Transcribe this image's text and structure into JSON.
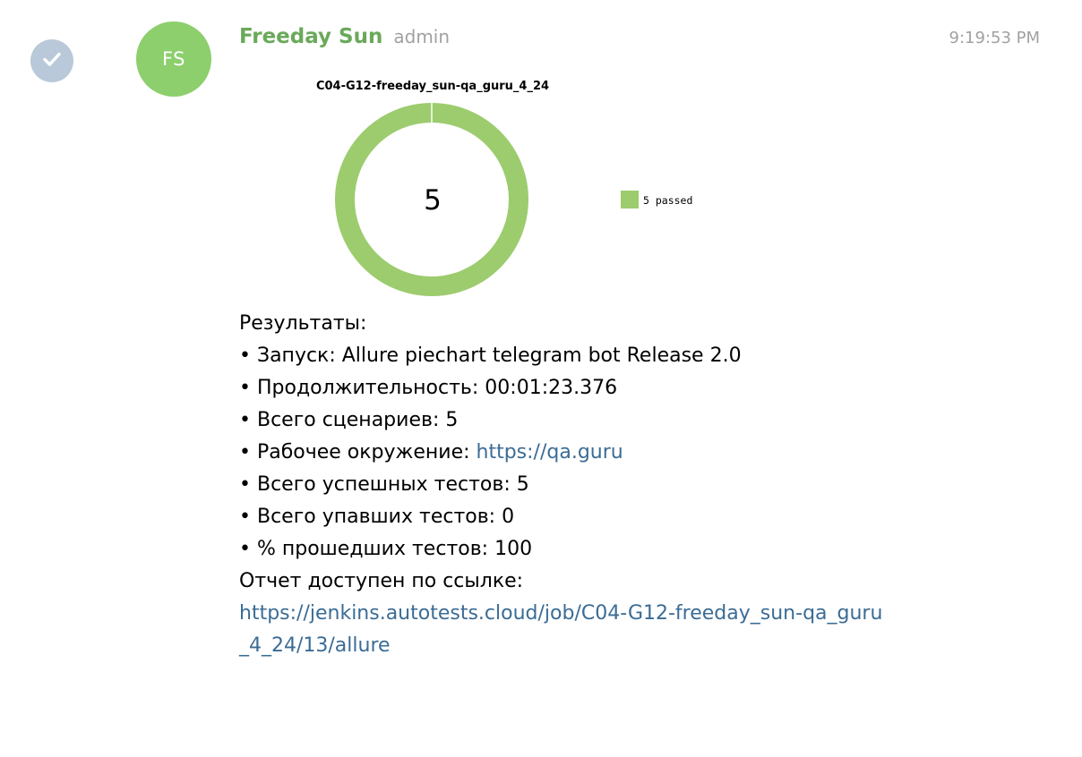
{
  "message": {
    "sender_initials": "FS",
    "sender_name": "Freeday Sun",
    "sender_role": "admin",
    "time": "9:19:53 PM",
    "results_heading": "Результаты:",
    "items": [
      {
        "label": "• Запуск: ",
        "value": "Allure piechart telegram bot Release 2.0"
      },
      {
        "label": "• Продолжительность: ",
        "value": "00:01:23.376"
      },
      {
        "label": "• Всего сценариев: ",
        "value": "5"
      },
      {
        "label": "• Рабочее окружение: ",
        "link": "https://qa.guru"
      },
      {
        "label": "• Всего успешных тестов: ",
        "value": "5"
      },
      {
        "label": "• Всего упавших тестов: ",
        "value": "0"
      },
      {
        "label": "• % прошедших тестов: ",
        "value": "100"
      }
    ],
    "report_label": "Отчет доступен по ссылке:",
    "report_link": "https://jenkins.autotests.cloud/job/C04-G12-freeday_sun-qa_guru_4_24/13/allure"
  },
  "icons": {
    "select": "check-icon",
    "avatar": "avatar-initials"
  },
  "colors": {
    "sender_name": "#6aa95a",
    "avatar_bg": "#8ccf6c",
    "check_bg": "#b9c9d9",
    "link": "#3b6c95",
    "meta_text": "#a1a1a1"
  },
  "chart_data": {
    "type": "pie",
    "style": "donut",
    "title": "C04-G12-freeday_sun-qa_guru_4_24",
    "center_label": "5",
    "categories": [
      "5 passed"
    ],
    "values": [
      5
    ],
    "colors": [
      "#9ccc6e"
    ],
    "legend_position": "right"
  }
}
